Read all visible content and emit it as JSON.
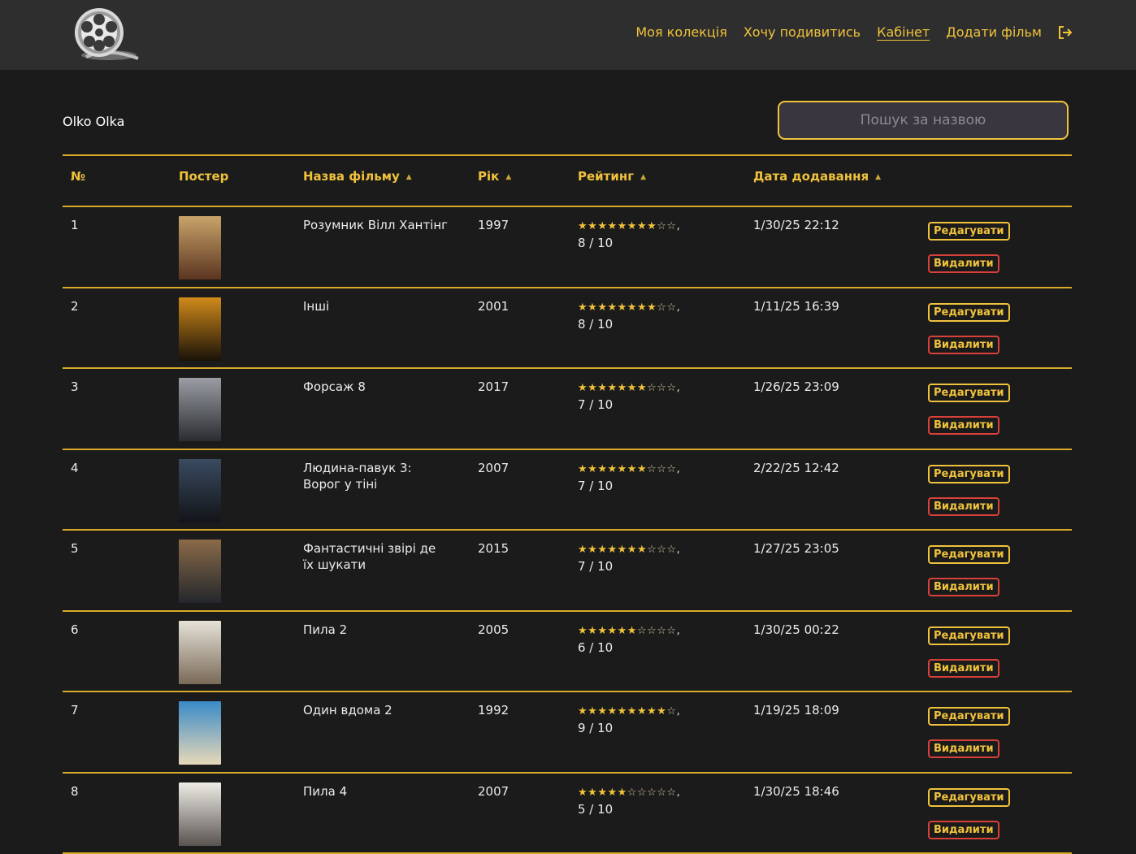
{
  "nav": {
    "items": [
      {
        "label": "Моя колекція",
        "active": false
      },
      {
        "label": "Хочу подивитись",
        "active": false
      },
      {
        "label": "Кабінет",
        "active": true
      },
      {
        "label": "Додати фільм",
        "active": false
      }
    ],
    "logout_icon": "logout-icon"
  },
  "user": {
    "name": "Olko Olka"
  },
  "search": {
    "placeholder": "Пошук за назвою",
    "value": ""
  },
  "table": {
    "headers": {
      "num": "№",
      "poster": "Постер",
      "title": "Назва фільму",
      "year": "Рік",
      "rating": "Рейтинг",
      "date": "Дата додавання"
    },
    "sort_icon": "▲",
    "edit_label": "Редагувати",
    "delete_label": "Видалити",
    "rows": [
      {
        "num": "1",
        "title": "Розумник Вілл Хантінг",
        "year": "1997",
        "rating": 8,
        "rating_text": "8 / 10",
        "date": "1/30/25 22:12",
        "poster_colors": [
          "#c9a46a",
          "#5a3420"
        ]
      },
      {
        "num": "2",
        "title": "Інші",
        "year": "2001",
        "rating": 8,
        "rating_text": "8 / 10",
        "date": "1/11/25 16:39",
        "poster_colors": [
          "#d08a1a",
          "#1a1208"
        ]
      },
      {
        "num": "3",
        "title": "Форсаж 8",
        "year": "2017",
        "rating": 7,
        "rating_text": "7 / 10",
        "date": "1/26/25 23:09",
        "poster_colors": [
          "#9a9ea4",
          "#2a2c30"
        ]
      },
      {
        "num": "4",
        "title": "Людина-павук 3: Ворог у тіні",
        "year": "2007",
        "rating": 7,
        "rating_text": "7 / 10",
        "date": "2/22/25 12:42",
        "poster_colors": [
          "#3a4a60",
          "#121418"
        ]
      },
      {
        "num": "5",
        "title": "Фантастичні звірі де їх шукати",
        "year": "2015",
        "rating": 7,
        "rating_text": "7 / 10",
        "date": "1/27/25 23:05",
        "poster_colors": [
          "#8a6a48",
          "#23272c"
        ]
      },
      {
        "num": "6",
        "title": "Пила 2",
        "year": "2005",
        "rating": 6,
        "rating_text": "6 / 10",
        "date": "1/30/25 00:22",
        "poster_colors": [
          "#e6e2d8",
          "#7a6a58"
        ]
      },
      {
        "num": "7",
        "title": "Один вдома 2",
        "year": "1992",
        "rating": 9,
        "rating_text": "9 / 10",
        "date": "1/19/25 18:09",
        "poster_colors": [
          "#3a8ac8",
          "#e8d8b8"
        ]
      },
      {
        "num": "8",
        "title": "Пила 4",
        "year": "2007",
        "rating": 5,
        "rating_text": "5 / 10",
        "date": "1/30/25 18:46",
        "poster_colors": [
          "#efece6",
          "#5a5450"
        ]
      }
    ]
  },
  "colors": {
    "accent": "#f0c23c",
    "danger": "#d9403a",
    "background": "#1b1b1b",
    "topbar": "#2e2e2e"
  }
}
